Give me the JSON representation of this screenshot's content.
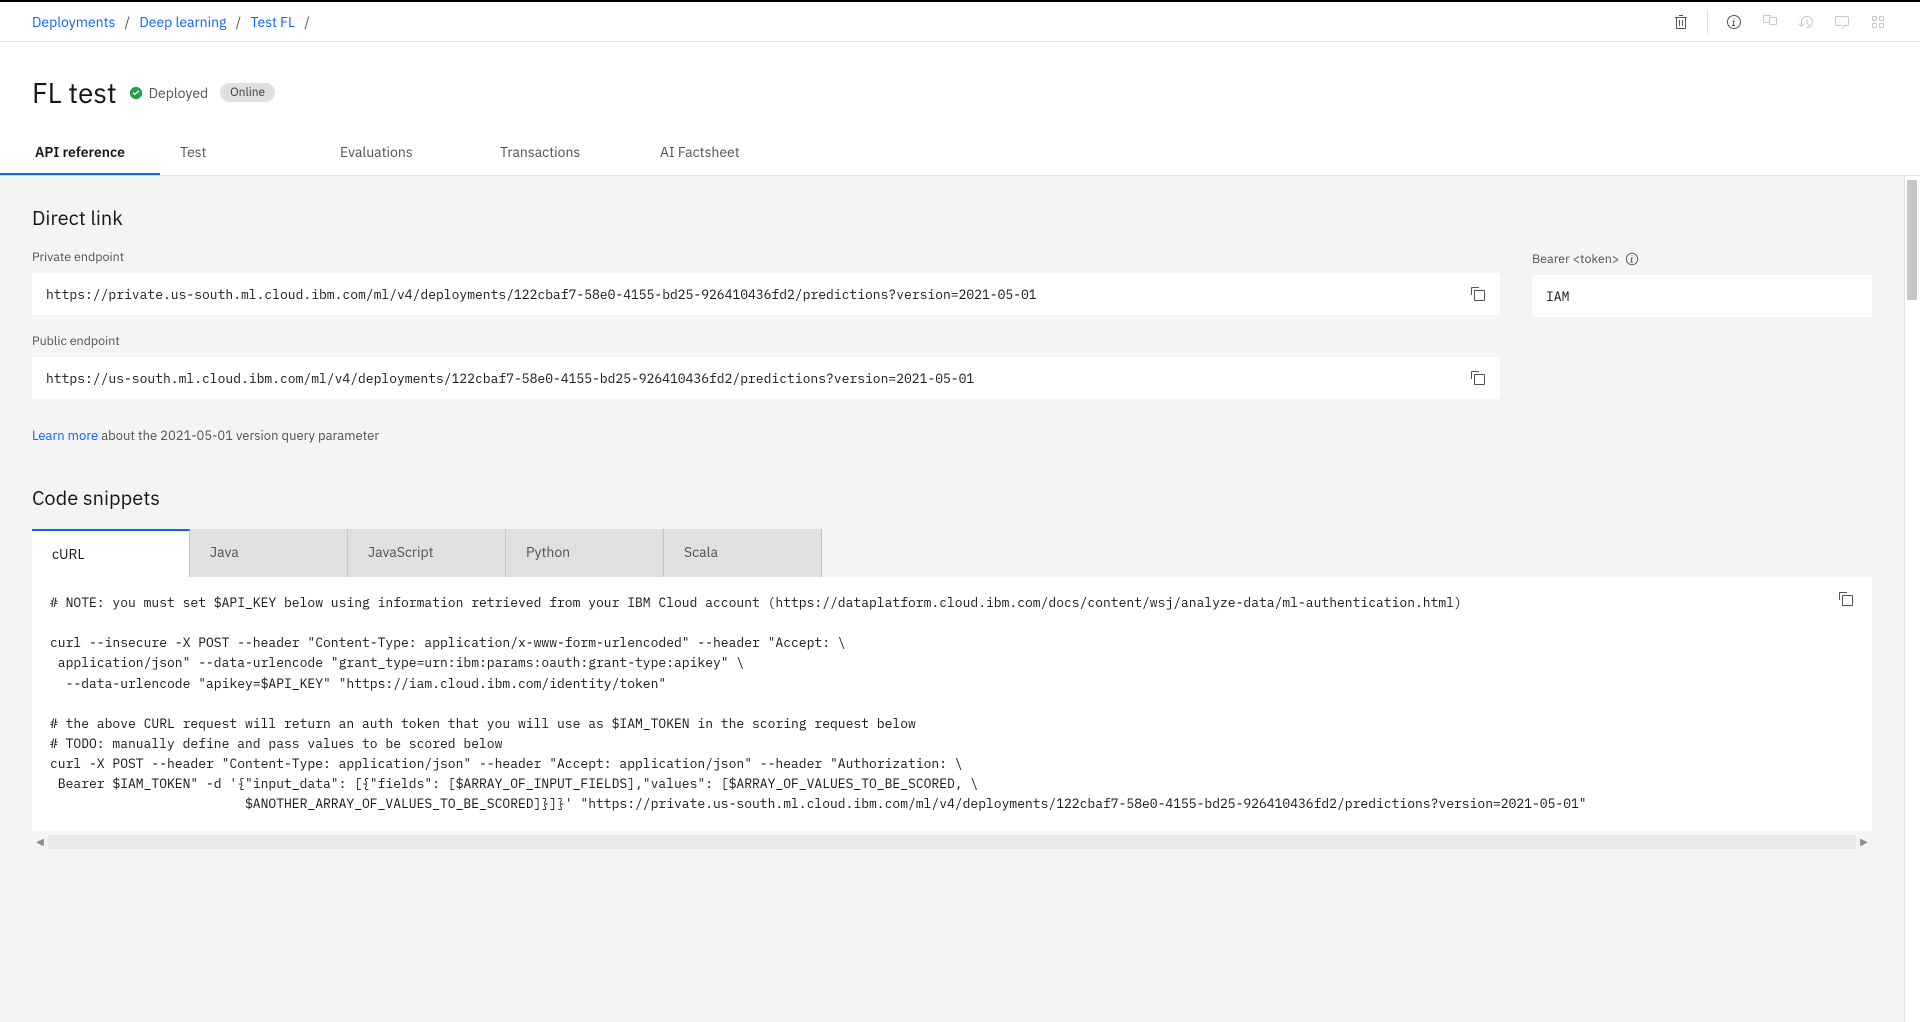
{
  "breadcrumb": {
    "deployments": "Deployments",
    "project": "Deep learning",
    "asset": "Test FL"
  },
  "page": {
    "title": "FL test",
    "status_label": "Deployed",
    "online_label": "Online"
  },
  "tabs": {
    "api_reference": "API reference",
    "test": "Test",
    "evaluations": "Evaluations",
    "transactions": "Transactions",
    "ai_factsheet": "AI Factsheet"
  },
  "direct_link": {
    "heading": "Direct link",
    "private_label": "Private endpoint",
    "private_url": "https://private.us-south.ml.cloud.ibm.com/ml/v4/deployments/122cbaf7-58e0-4155-bd25-926410436fd2/predictions?version=2021-05-01",
    "public_label": "Public endpoint",
    "public_url": "https://us-south.ml.cloud.ibm.com/ml/v4/deployments/122cbaf7-58e0-4155-bd25-926410436fd2/predictions?version=2021-05-01",
    "bearer_label": "Bearer <token>",
    "bearer_value": "IAM",
    "learn_more_link": "Learn more",
    "learn_more_text": " about the 2021-05-01 version query parameter"
  },
  "code_snippets": {
    "heading": "Code snippets",
    "tabs": {
      "curl": "cURL",
      "java": "Java",
      "javascript": "JavaScript",
      "python": "Python",
      "scala": "Scala"
    },
    "curl_code": "# NOTE: you must set $API_KEY below using information retrieved from your IBM Cloud account (https://dataplatform.cloud.ibm.com/docs/content/wsj/analyze-data/ml-authentication.html)\n\ncurl --insecure -X POST --header \"Content-Type: application/x-www-form-urlencoded\" --header \"Accept: \\\n application/json\" --data-urlencode \"grant_type=urn:ibm:params:oauth:grant-type:apikey\" \\\n  --data-urlencode \"apikey=$API_KEY\" \"https://iam.cloud.ibm.com/identity/token\"\n\n# the above CURL request will return an auth token that you will use as $IAM_TOKEN in the scoring request below\n# TODO: manually define and pass values to be scored below\ncurl -X POST --header \"Content-Type: application/json\" --header \"Accept: application/json\" --header \"Authorization: \\\n Bearer $IAM_TOKEN\" -d '{\"input_data\": [{\"fields\": [$ARRAY_OF_INPUT_FIELDS],\"values\": [$ARRAY_OF_VALUES_TO_BE_SCORED, \\\n                         $ANOTHER_ARRAY_OF_VALUES_TO_BE_SCORED]}]}' \"https://private.us-south.ml.cloud.ibm.com/ml/v4/deployments/122cbaf7-58e0-4155-bd25-926410436fd2/predictions?version=2021-05-01\""
  }
}
